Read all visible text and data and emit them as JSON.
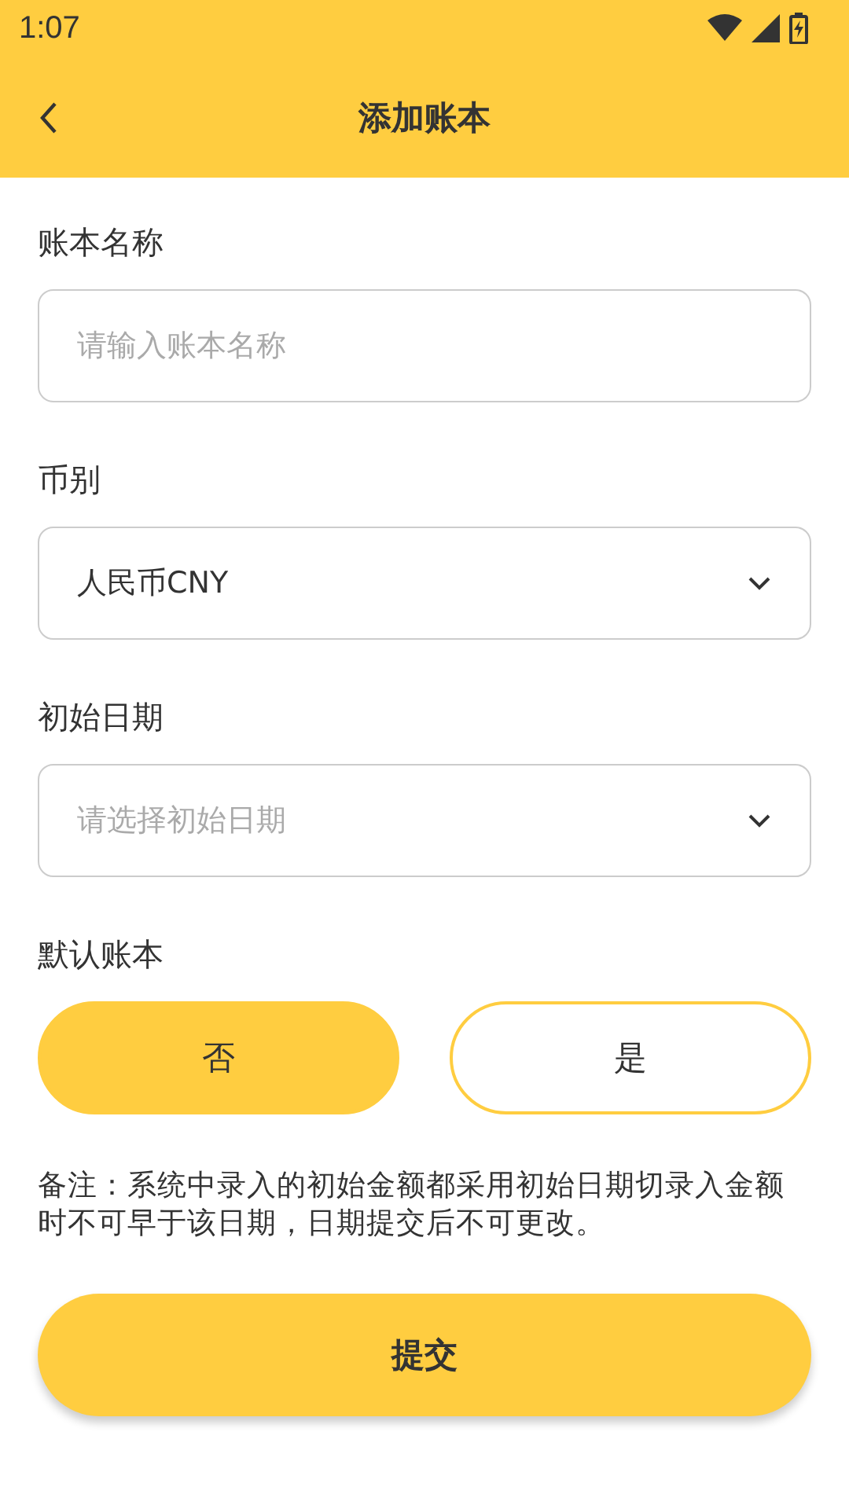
{
  "status_bar": {
    "time": "1:07"
  },
  "header": {
    "title": "添加账本"
  },
  "fields": [
    {
      "label": "账本名称",
      "kind": "text",
      "placeholder": "请输入账本名称"
    },
    {
      "label": "币别",
      "kind": "select",
      "value": "人民币CNY"
    },
    {
      "label": "初始日期",
      "kind": "select",
      "placeholder": "请选择初始日期"
    }
  ],
  "default_book": {
    "label": "默认账本",
    "options": [
      {
        "label": "否",
        "selected": true
      },
      {
        "label": "是",
        "selected": false
      }
    ]
  },
  "note": "备注：系统中录入的初始金额都采用初始日期切录入金额时不可早于该日期，日期提交后不可更改。",
  "submit": "提交"
}
